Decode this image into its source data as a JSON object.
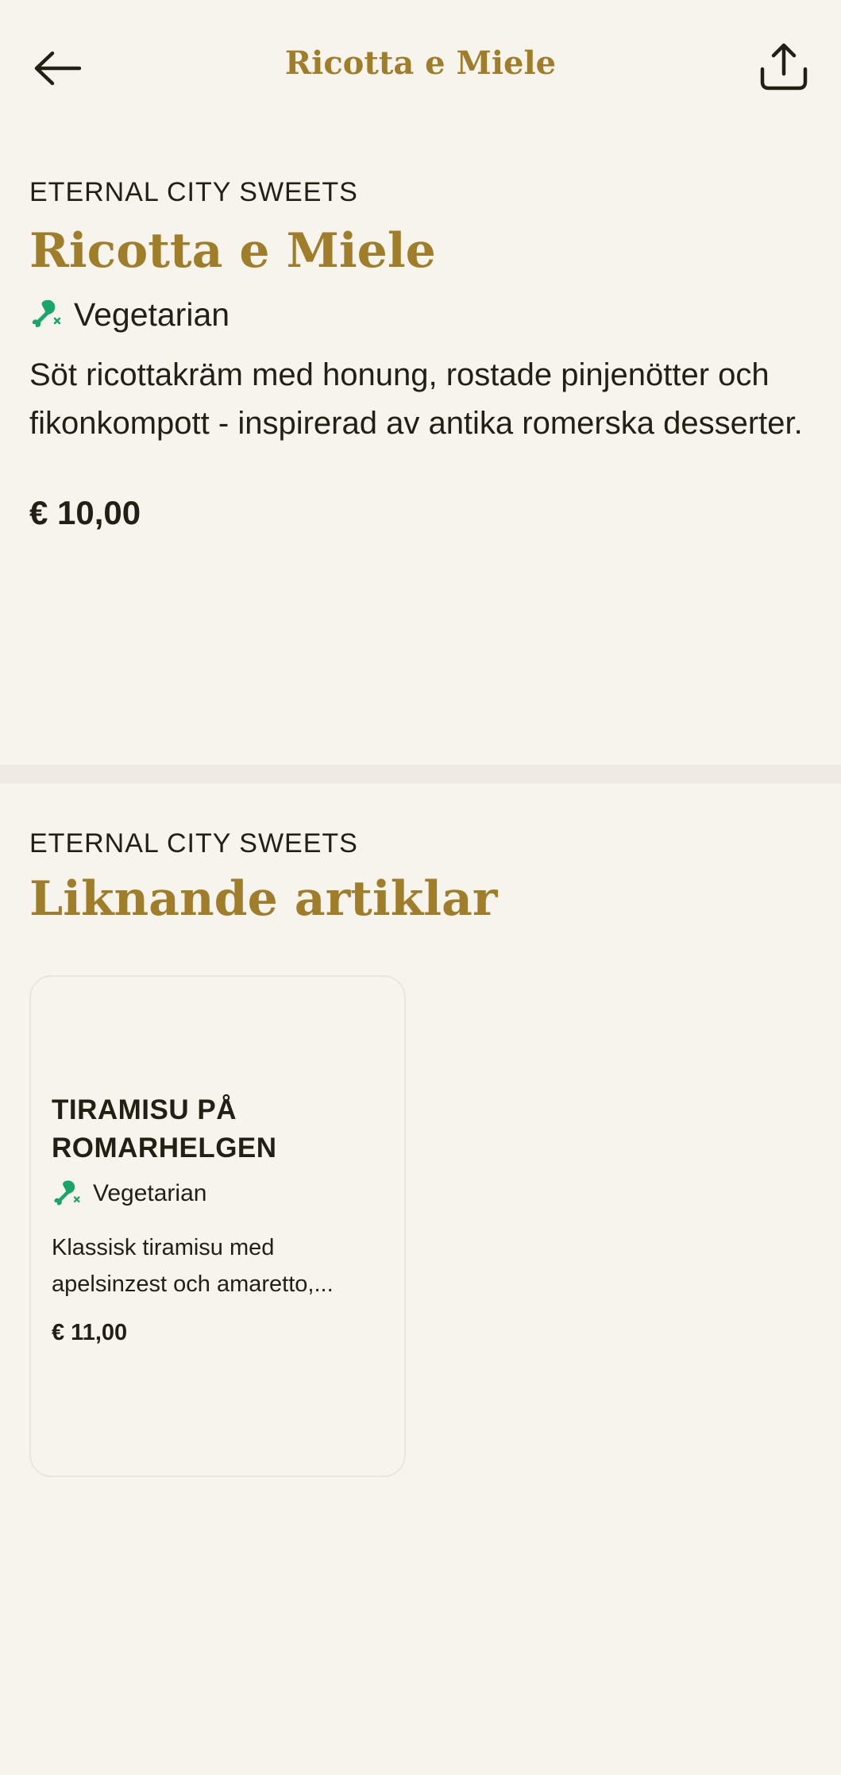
{
  "header": {
    "title": "Ricotta e Miele",
    "back_icon": "arrow-left-icon",
    "share_icon": "share-icon"
  },
  "product": {
    "category": "ETERNAL CITY SWEETS",
    "name": "Ricotta e Miele",
    "diet_label": "Vegetarian",
    "diet_icon": "vegetarian-drumstick-off-icon",
    "description": "Söt ricottakräm med honung, rostade pinjenötter och fikonkompott - inspirerad av antika romerska desserter.",
    "price": "€ 10,00"
  },
  "similar": {
    "category": "ETERNAL CITY SWEETS",
    "title": "Liknande artiklar",
    "items": [
      {
        "name": "TIRAMISU PÅ ROMARHELGEN",
        "diet_label": "Vegetarian",
        "description": "Klassisk tiramisu med apelsinzest och amaretto,...",
        "price": "€ 11,00"
      }
    ]
  },
  "colors": {
    "accent": "#a07d28",
    "background": "#f7f4ee",
    "divider": "#efebe2",
    "vegetarian_green": "#1aa66a",
    "text": "#231f14"
  }
}
